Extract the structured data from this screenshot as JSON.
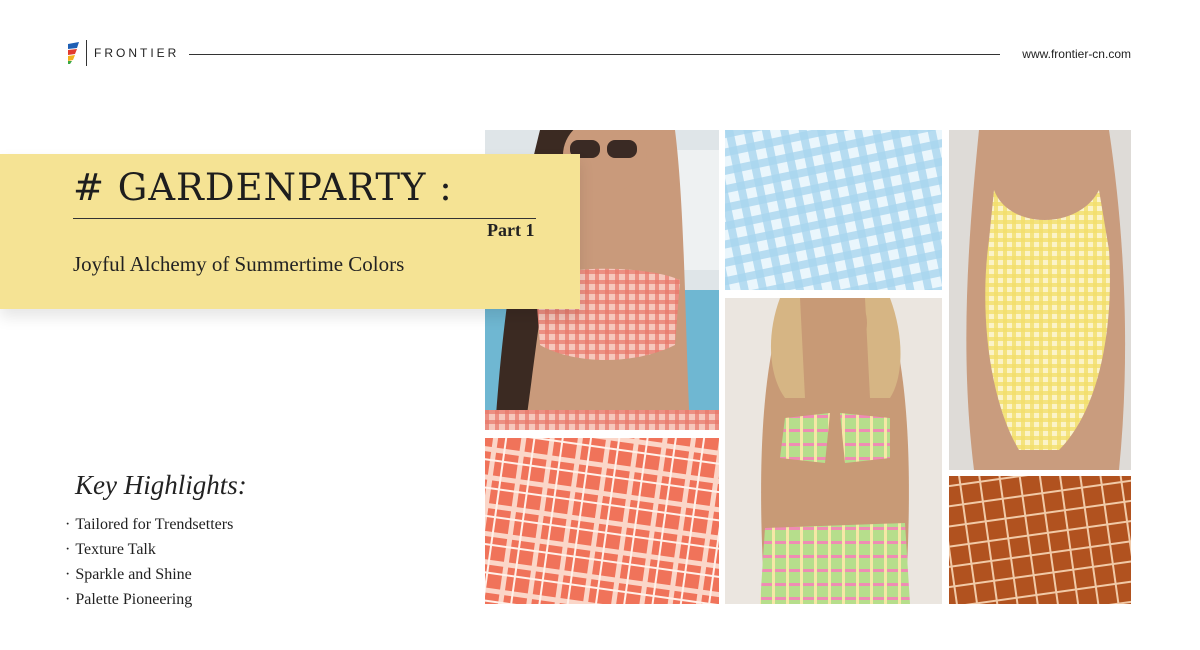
{
  "header": {
    "brand": "FRONTIER",
    "url": "www.frontier-cn.com"
  },
  "hero": {
    "title": "# GARDENPARTY :",
    "part": "Part 1",
    "subtitle": "Joyful Alchemy of Summertime Colors"
  },
  "highlights": {
    "title": "Key Highlights:",
    "bullet": "·",
    "items": [
      "Tailored for Trendsetters",
      "Texture Talk",
      "Sparkle and Shine",
      "Palette Pioneering"
    ]
  },
  "colors": {
    "title_panel": "#f5e394",
    "coral_plaid": "#f0735a",
    "sky_gingham": "#a9d6ef",
    "lime_plaid": "#a9d67f",
    "yellow_gingham": "#f3df6c",
    "rust_check": "#b1521f"
  }
}
